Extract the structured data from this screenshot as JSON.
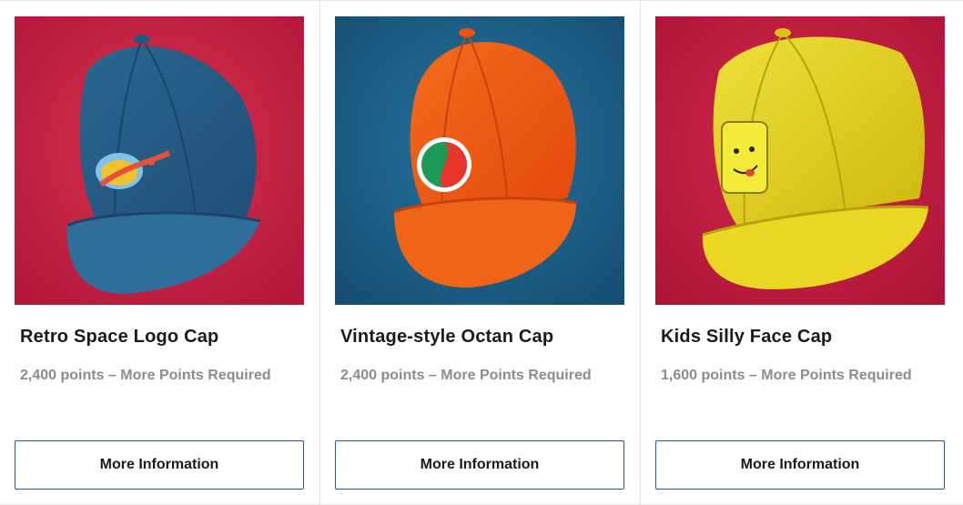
{
  "products": [
    {
      "title": "Retro Space Logo Cap",
      "points": "2,400 points – More Points Required",
      "button_label": "More Information",
      "image": {
        "name": "blue-space-logo-cap-image",
        "background": "#c8223f",
        "cap_color": "#2f6a93",
        "logo": "space-logo-icon"
      }
    },
    {
      "title": "Vintage-style Octan Cap",
      "points": "2,400 points – More Points Required",
      "button_label": "More Information",
      "image": {
        "name": "orange-octan-cap-image",
        "background": "#1f5f86",
        "cap_color": "#f25a12",
        "logo": "octan-logo-icon"
      }
    },
    {
      "title": "Kids Silly Face Cap",
      "points": "1,600 points – More Points Required",
      "button_label": "More Information",
      "image": {
        "name": "yellow-silly-face-cap-image",
        "background": "#c81f45",
        "cap_color": "#e6d21a",
        "logo": "minifig-face-icon"
      }
    }
  ]
}
